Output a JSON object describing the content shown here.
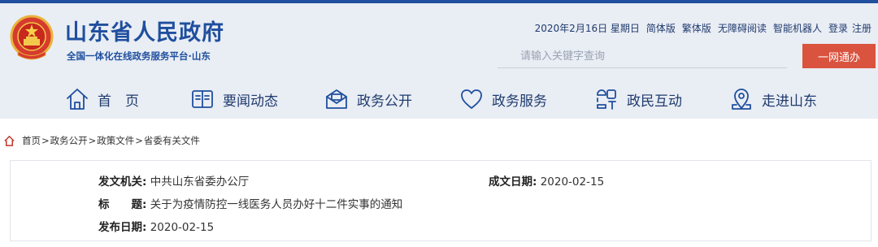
{
  "header": {
    "site_title": "山东省人民政府",
    "site_subtitle": "全国一体化在线政务服务平台·山东",
    "date": "2020年2月16日 星期日",
    "links": [
      "简体版",
      "繁体版",
      "无障碍阅读",
      "智能机器人",
      "登录",
      "注册"
    ],
    "search_placeholder": "请输入关键字查询",
    "search_button": "一网通办"
  },
  "nav": {
    "items": [
      {
        "label": "首　页",
        "icon": "home-icon"
      },
      {
        "label": "要闻动态",
        "icon": "book-icon"
      },
      {
        "label": "政务公开",
        "icon": "mail-open-icon"
      },
      {
        "label": "政务服务",
        "icon": "heart-icon"
      },
      {
        "label": "政民互动",
        "icon": "interaction-icon"
      },
      {
        "label": "走进山东",
        "icon": "location-pin-icon"
      }
    ]
  },
  "breadcrumb": [
    "首页",
    "政务公开",
    "政策文件",
    "省委有关文件"
  ],
  "document": {
    "issuer_label": "发文机关:",
    "issuer": "中共山东省委办公厅",
    "date_label": "成文日期:",
    "date": "2020-02-15",
    "title_label": "标　　题:",
    "title": "关于为疫情防控一线医务人员办好十二件实事的通知",
    "publish_label": "发布日期:",
    "publish_date": "2020-02-15"
  },
  "colors": {
    "brand_blue": "#1f4f9e",
    "header_bg": "#e9edf4",
    "accent_red": "#d9533f"
  }
}
